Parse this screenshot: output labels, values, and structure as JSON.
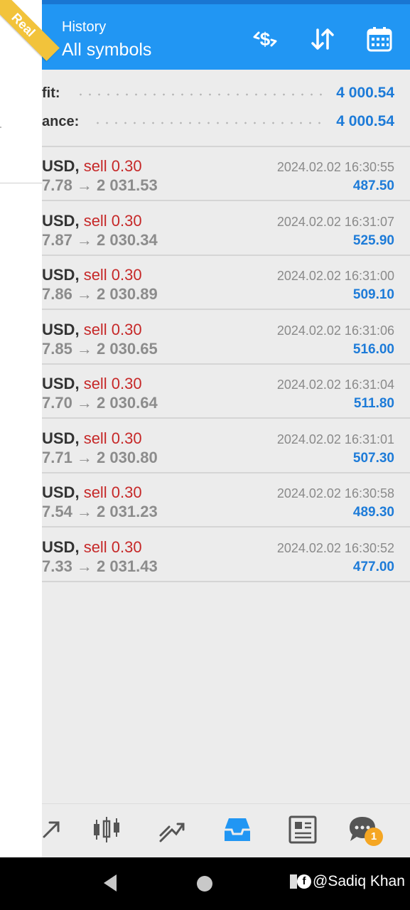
{
  "badge": {
    "label": "Real"
  },
  "header": {
    "subtitle": "History",
    "title": "All symbols"
  },
  "summary": [
    {
      "label": "fit:",
      "value": "4 000.54"
    },
    {
      "label": "ance:",
      "value": "4 000.54"
    }
  ],
  "deals": [
    {
      "symbol": "USD,",
      "side": "sell 0.30",
      "prices": "7.78 → 2 031.53",
      "time": "2024.02.02 16:30:55",
      "profit": "487.50"
    },
    {
      "symbol": "USD,",
      "side": "sell 0.30",
      "prices": "7.87 → 2 030.34",
      "time": "2024.02.02 16:31:07",
      "profit": "525.90"
    },
    {
      "symbol": "USD,",
      "side": "sell 0.30",
      "prices": "7.86 → 2 030.89",
      "time": "2024.02.02 16:31:00",
      "profit": "509.10"
    },
    {
      "symbol": "USD,",
      "side": "sell 0.30",
      "prices": "7.85 → 2 030.65",
      "time": "2024.02.02 16:31:06",
      "profit": "516.00"
    },
    {
      "symbol": "USD,",
      "side": "sell 0.30",
      "prices": "7.70 → 2 030.64",
      "time": "2024.02.02 16:31:04",
      "profit": "511.80"
    },
    {
      "symbol": "USD,",
      "side": "sell 0.30",
      "prices": "7.71 → 2 030.80",
      "time": "2024.02.02 16:31:01",
      "profit": "507.30"
    },
    {
      "symbol": "USD,",
      "side": "sell 0.30",
      "prices": "7.54 → 2 031.23",
      "time": "2024.02.02 16:30:58",
      "profit": "489.30"
    },
    {
      "symbol": "USD,",
      "side": "sell 0.30",
      "prices": "7.33 → 2 031.43",
      "time": "2024.02.02 16:30:52",
      "profit": "477.00"
    }
  ],
  "nav": {
    "chat_badge": "1"
  },
  "watermark": {
    "text": "@Sadiq Khan"
  },
  "colors": {
    "header": "#2196f3",
    "profit": "#1d7bd8",
    "sell": "#c62828",
    "badge": "#f2c33b"
  }
}
